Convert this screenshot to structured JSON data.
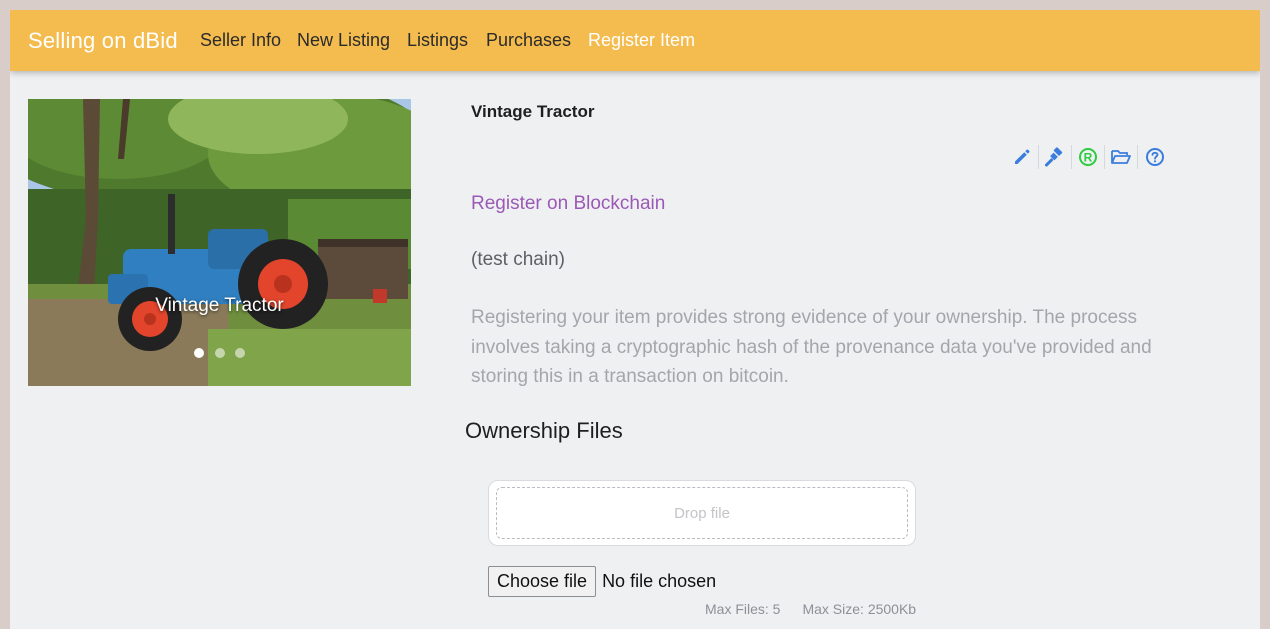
{
  "navbar": {
    "brand": "Selling on dBid",
    "links": [
      {
        "label": "Seller Info",
        "active": false
      },
      {
        "label": "New Listing",
        "active": false
      },
      {
        "label": "Listings",
        "active": false
      },
      {
        "label": "Purchases",
        "active": false
      },
      {
        "label": "Register Item",
        "active": true
      }
    ]
  },
  "carousel": {
    "caption": "Vintage Tractor",
    "slide_count": 3,
    "active_slide": 1
  },
  "item": {
    "title": "Vintage Tractor",
    "toolbar_icons": [
      "pencil-icon",
      "gavel-icon",
      "registered-icon",
      "folder-open-icon",
      "question-circle-icon"
    ]
  },
  "register": {
    "link_label": "Register on Blockchain",
    "chain_note": "(test chain)",
    "description": "Registering your item provides strong evidence of your ownership. The process involves taking a cryptographic hash of the provenance data you've provided and storing this in a transaction on bitcoin."
  },
  "ownership_files": {
    "heading": "Ownership Files",
    "dropzone_placeholder": "Drop file",
    "choose_button_label": "Choose file",
    "file_status": "No file chosen",
    "max_files": "Max Files: 5",
    "max_size": "Max Size: 2500Kb"
  },
  "colors": {
    "navbar": "#f4bc4e",
    "accent_purple": "#9b59b6",
    "icon_blue": "#3b7ddd",
    "icon_green": "#2ecc40",
    "background": "#eff0f2"
  }
}
